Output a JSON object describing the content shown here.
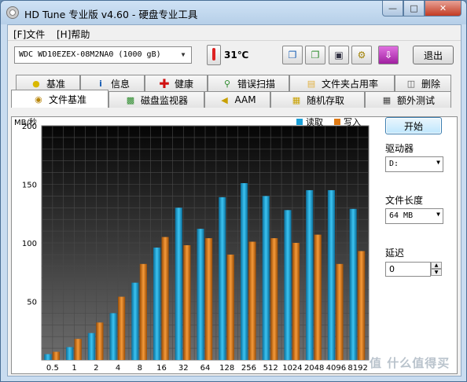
{
  "window": {
    "title": "HD Tune 专业版 v4.60 - 硬盘专业工具"
  },
  "menu": [
    "[F]文件",
    "[H]帮助"
  ],
  "toolbar": {
    "drive": "WDC WD10EZEX-08M2NA0 (1000 gB)",
    "temperature": "31℃",
    "exit_label": "退出"
  },
  "tabs_row1": [
    {
      "label": "基准",
      "icon": "yellow-bulb-icon",
      "color": "#d9b800"
    },
    {
      "label": "信息",
      "icon": "info-icon",
      "color": "#1a5fb4"
    },
    {
      "label": "健康",
      "icon": "red-cross-icon",
      "color": "#d01010"
    },
    {
      "label": "错误扫描",
      "icon": "magnifier-icon",
      "color": "#2a8a2a"
    },
    {
      "label": "文件夹占用率",
      "icon": "folder-icon",
      "color": "#e0b040"
    },
    {
      "label": "删除",
      "icon": "trash-icon",
      "color": "#555555"
    }
  ],
  "tabs_row2": [
    {
      "label": "文件基准",
      "icon": "file-bench-icon",
      "color": "#b8860b",
      "active": true
    },
    {
      "label": "磁盘监视器",
      "icon": "monitor-icon",
      "color": "#2a8a2a",
      "active": false
    },
    {
      "label": "AAM",
      "icon": "speaker-icon",
      "color": "#c8a000",
      "active": false
    },
    {
      "label": "随机存取",
      "icon": "random-icon",
      "color": "#c8a000",
      "active": false
    },
    {
      "label": "额外测试",
      "icon": "extra-icon",
      "color": "#444444",
      "active": false
    }
  ],
  "side": {
    "start_label": "开始",
    "drive_label": "驱动器",
    "drive_value": "D:",
    "filesize_label": "文件长度",
    "filesize_value": "64 MB",
    "delay_label": "延迟",
    "delay_value": "0"
  },
  "chart_data": {
    "type": "bar",
    "ylabel": "MB/秒",
    "ylim": [
      0,
      200
    ],
    "yticks": [
      50,
      100,
      150,
      200
    ],
    "categories": [
      "0.5",
      "1",
      "2",
      "4",
      "8",
      "16",
      "32",
      "64",
      "128",
      "256",
      "512",
      "1024",
      "2048",
      "4096",
      "8192"
    ],
    "series": [
      {
        "name": "读取",
        "color": "#1aa0d8",
        "values": [
          5,
          11,
          23,
          40,
          66,
          96,
          130,
          112,
          139,
          151,
          140,
          128,
          145,
          145,
          129
        ]
      },
      {
        "name": "写入",
        "color": "#e07a14",
        "values": [
          7,
          18,
          32,
          54,
          82,
          105,
          98,
          104,
          90,
          101,
          104,
          100,
          107,
          82,
          93
        ]
      }
    ],
    "grid": true,
    "legend": "top-right"
  },
  "watermark": "值 什么值得买"
}
